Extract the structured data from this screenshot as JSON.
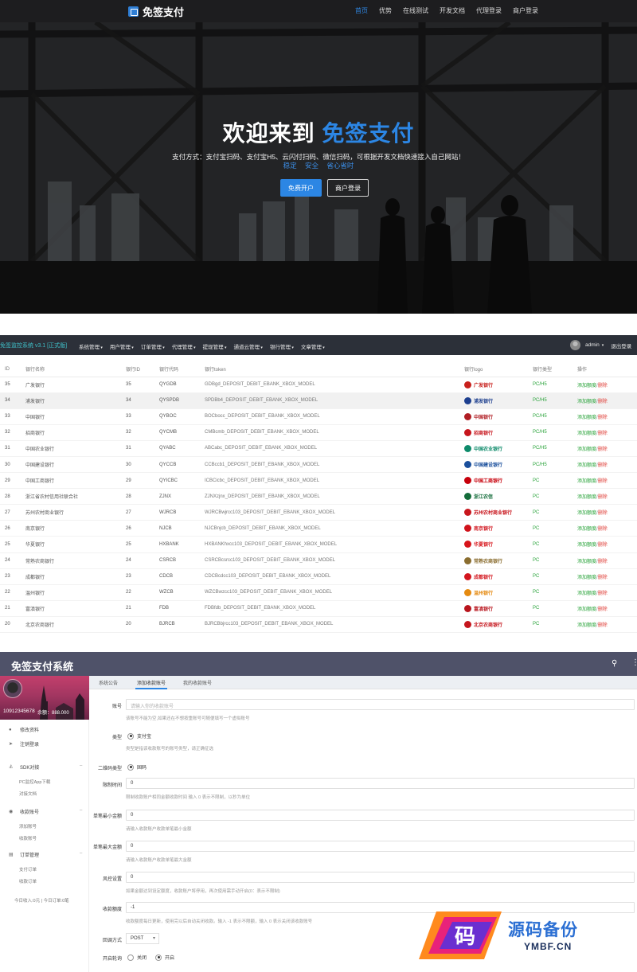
{
  "hero": {
    "brand": "免签支付",
    "nav": [
      {
        "label": "首页",
        "active": true
      },
      {
        "label": "优势",
        "active": false
      },
      {
        "label": "在线测试",
        "active": false
      },
      {
        "label": "开发文档",
        "active": false
      },
      {
        "label": "代理登录",
        "active": false
      },
      {
        "label": "商户登录",
        "active": false
      }
    ],
    "title_white": "欢迎来到",
    "title_blue": "免签支付",
    "subtitle": "支付方式：支付宝扫码、支付宝H5、云闪付扫码、微信扫码，可根据开发文档快速接入自己网站！",
    "tags": [
      "稳定",
      "安全",
      "省心省时"
    ],
    "btn_register": "免费开户",
    "btn_login": "商户登录",
    "accent": "#2c86e4"
  },
  "admin": {
    "system_title": "免签监控系统 v3.1 [正式版]",
    "menus": [
      "系统管理",
      "用户管理",
      "订单管理",
      "代理管理",
      "提现管理",
      "通道云管理",
      "银行管理",
      "文章管理"
    ],
    "user": "admin",
    "logout": "退出登录",
    "columns": [
      "ID",
      "银行名称",
      "银行ID",
      "银行代码",
      "银行token",
      "银行logo",
      "银行类型",
      "操作"
    ],
    "op_add": "添加额度",
    "op_sep": "/",
    "op_del": "删除",
    "rows": [
      {
        "id": "35",
        "name": "广发银行",
        "bid": "35",
        "code": "QYGDB",
        "token": "GDBgd_DEPOSIT_DEBIT_EBANK_XBOX_MODEL",
        "logo": "广发银行",
        "logo_color": "#c8201c",
        "type": "PC/H5",
        "hl": false
      },
      {
        "id": "34",
        "name": "浦发银行",
        "bid": "34",
        "code": "QYSPDB",
        "token": "SPDBb4_DEPOSIT_DEBIT_EBANK_XBOX_MODEL",
        "logo": "浦发银行",
        "logo_color": "#1d3f8f",
        "type": "PC/H5",
        "hl": true
      },
      {
        "id": "33",
        "name": "中国银行",
        "bid": "33",
        "code": "QYBOC",
        "token": "BOCbocc_DEPOSIT_DEBIT_EBANK_XBOX_MODEL",
        "logo": "中国银行",
        "logo_color": "#b01d23",
        "type": "PC/H5",
        "hl": false
      },
      {
        "id": "32",
        "name": "招商银行",
        "bid": "32",
        "code": "QYCMB",
        "token": "CMBcmb_DEPOSIT_DEBIT_EBANK_XBOX_MODEL",
        "logo": "招商银行",
        "logo_color": "#c7161d",
        "type": "PC/H5",
        "hl": false
      },
      {
        "id": "31",
        "name": "中国农业银行",
        "bid": "31",
        "code": "QYABC",
        "token": "ABCabc_DEPOSIT_DEBIT_EBANK_XBOX_MODEL",
        "logo": "中国农业银行",
        "logo_color": "#0d8a6a",
        "type": "PC/H5",
        "hl": false
      },
      {
        "id": "30",
        "name": "中国建设银行",
        "bid": "30",
        "code": "QYCCB",
        "token": "CCBccb1_DEPOSIT_DEBIT_EBANK_XBOX_MODEL",
        "logo": "中国建设银行",
        "logo_color": "#1a4f9c",
        "type": "PC/H5",
        "hl": false
      },
      {
        "id": "29",
        "name": "中国工商银行",
        "bid": "29",
        "code": "QYICBC",
        "token": "ICBCicbc_DEPOSIT_DEBIT_EBANK_XBOX_MODEL",
        "logo": "中国工商银行",
        "logo_color": "#c7000b",
        "type": "PC",
        "hl": false
      },
      {
        "id": "28",
        "name": "浙江省农村信用社联合社",
        "bid": "28",
        "code": "ZJNX",
        "token": "ZJNXzjnx_DEPOSIT_DEBIT_EBANK_XBOX_MODEL",
        "logo": "浙江农信",
        "logo_color": "#136c3a",
        "type": "PC",
        "hl": false
      },
      {
        "id": "27",
        "name": "苏州农村商业银行",
        "bid": "27",
        "code": "WJRCB",
        "token": "WJRCBwjrcc103_DEPOSIT_DEBIT_EBANK_XBOX_MODEL",
        "logo": "苏州农村商业银行",
        "logo_color": "#c8161d",
        "type": "PC",
        "hl": false
      },
      {
        "id": "26",
        "name": "南京银行",
        "bid": "26",
        "code": "NJCB",
        "token": "NJCBnjcb_DEPOSIT_DEBIT_EBANK_XBOX_MODEL",
        "logo": "南京银行",
        "logo_color": "#d0121b",
        "type": "PC",
        "hl": false
      },
      {
        "id": "25",
        "name": "华夏银行",
        "bid": "25",
        "code": "HXBANK",
        "token": "HXBANKhxcc103_DEPOSIT_DEBIT_EBANK_XBOX_MODEL",
        "logo": "华夏银行",
        "logo_color": "#d7141a",
        "type": "PC",
        "hl": false
      },
      {
        "id": "24",
        "name": "常熟农商银行",
        "bid": "24",
        "code": "CSRCB",
        "token": "CSRCBcsrcc103_DEPOSIT_DEBIT_EBANK_XBOX_MODEL",
        "logo": "常熟农商银行",
        "logo_color": "#8a6d2f",
        "type": "PC",
        "hl": false
      },
      {
        "id": "23",
        "name": "成都银行",
        "bid": "23",
        "code": "CDCB",
        "token": "CDCBcdcc103_DEPOSIT_DEBIT_EBANK_XBOX_MODEL",
        "logo": "成都银行",
        "logo_color": "#d3151d",
        "type": "PC",
        "hl": false
      },
      {
        "id": "22",
        "name": "温州银行",
        "bid": "22",
        "code": "WZCB",
        "token": "WZCBwzcc103_DEPOSIT_DEBIT_EBANK_XBOX_MODEL",
        "logo": "温州银行",
        "logo_color": "#e58a10",
        "type": "PC",
        "hl": false
      },
      {
        "id": "21",
        "name": "富滇银行",
        "bid": "21",
        "code": "FDB",
        "token": "FDBfdb_DEPOSIT_DEBIT_EBANK_XBOX_MODEL",
        "logo": "富滇银行",
        "logo_color": "#b8141c",
        "type": "PC",
        "hl": false
      },
      {
        "id": "20",
        "name": "北京农商银行",
        "bid": "20",
        "code": "BJRCB",
        "token": "BJRCBbjrcc103_DEPOSIT_DEBIT_EBANK_XBOX_MODEL",
        "logo": "北京农商银行",
        "logo_color": "#c5161d",
        "type": "PC",
        "hl": false
      }
    ]
  },
  "merchant": {
    "title": "免签支付系统",
    "profile": {
      "uid": "10912345678",
      "balance": "余额：888.000"
    },
    "menu": {
      "edit_profile": "修改资料",
      "logout": "注销登录",
      "sdk": "SDK对接",
      "sdk_sub": [
        "PC监控App下载",
        "对接文档"
      ],
      "accounts": "收款账号",
      "accounts_sub": [
        "添加账号",
        "收款账号"
      ],
      "orders": "订单管理",
      "orders_sub": [
        "支付订单",
        "收款订单"
      ],
      "footer": "今日收入:0元 | 今日订单:0笔"
    },
    "tabs": [
      "系统公告",
      "添加收款账号",
      "我的收款账号"
    ],
    "form": {
      "account_label": "账号",
      "account_placeholder": "请输入你的收款账号",
      "account_help": "该账号不能为空,如果还在不想按重账号可随便填写一个虚拟账号",
      "type_label": "类型",
      "type_value": "支付宝",
      "type_help": "类型是指该收款账号的账号类型，请正确征选",
      "qr_label": "二维码类型",
      "qr_value": "固码",
      "limit_time_label": "限制时间",
      "limit_time_value": "0",
      "limit_time_help": "限制收款账户相同金额收款时间 输入 0 表示不限制，以秒为单位",
      "min_label": "单笔最小金额",
      "min_value": "0",
      "min_help": "请输入收款账户收款单笔最小金额",
      "max_label": "单笔最大金额",
      "max_value": "0",
      "max_help": "请输入收款账户收款单笔最大金额",
      "risk_label": "风控设置",
      "risk_value": "0",
      "risk_help": "如果金额达到设定额度，收款账户将停用，再次使用需手动开启(0：表示不限制)",
      "quota_label": "收款额度",
      "quota_value": "-1",
      "quota_help": "收款额度每日更新，使用完以后自动关闭收款。输入 -1 表示不限额，输入 0 表示关闭该收款账号",
      "callback_label": "回调方式",
      "callback_value": "POST",
      "poll_label": "开启轮询",
      "poll_off": "关闭",
      "poll_on": "开启"
    }
  },
  "watermark": {
    "cn": "源码备份",
    "en": "YMBF.CN",
    "glyph": "码"
  }
}
